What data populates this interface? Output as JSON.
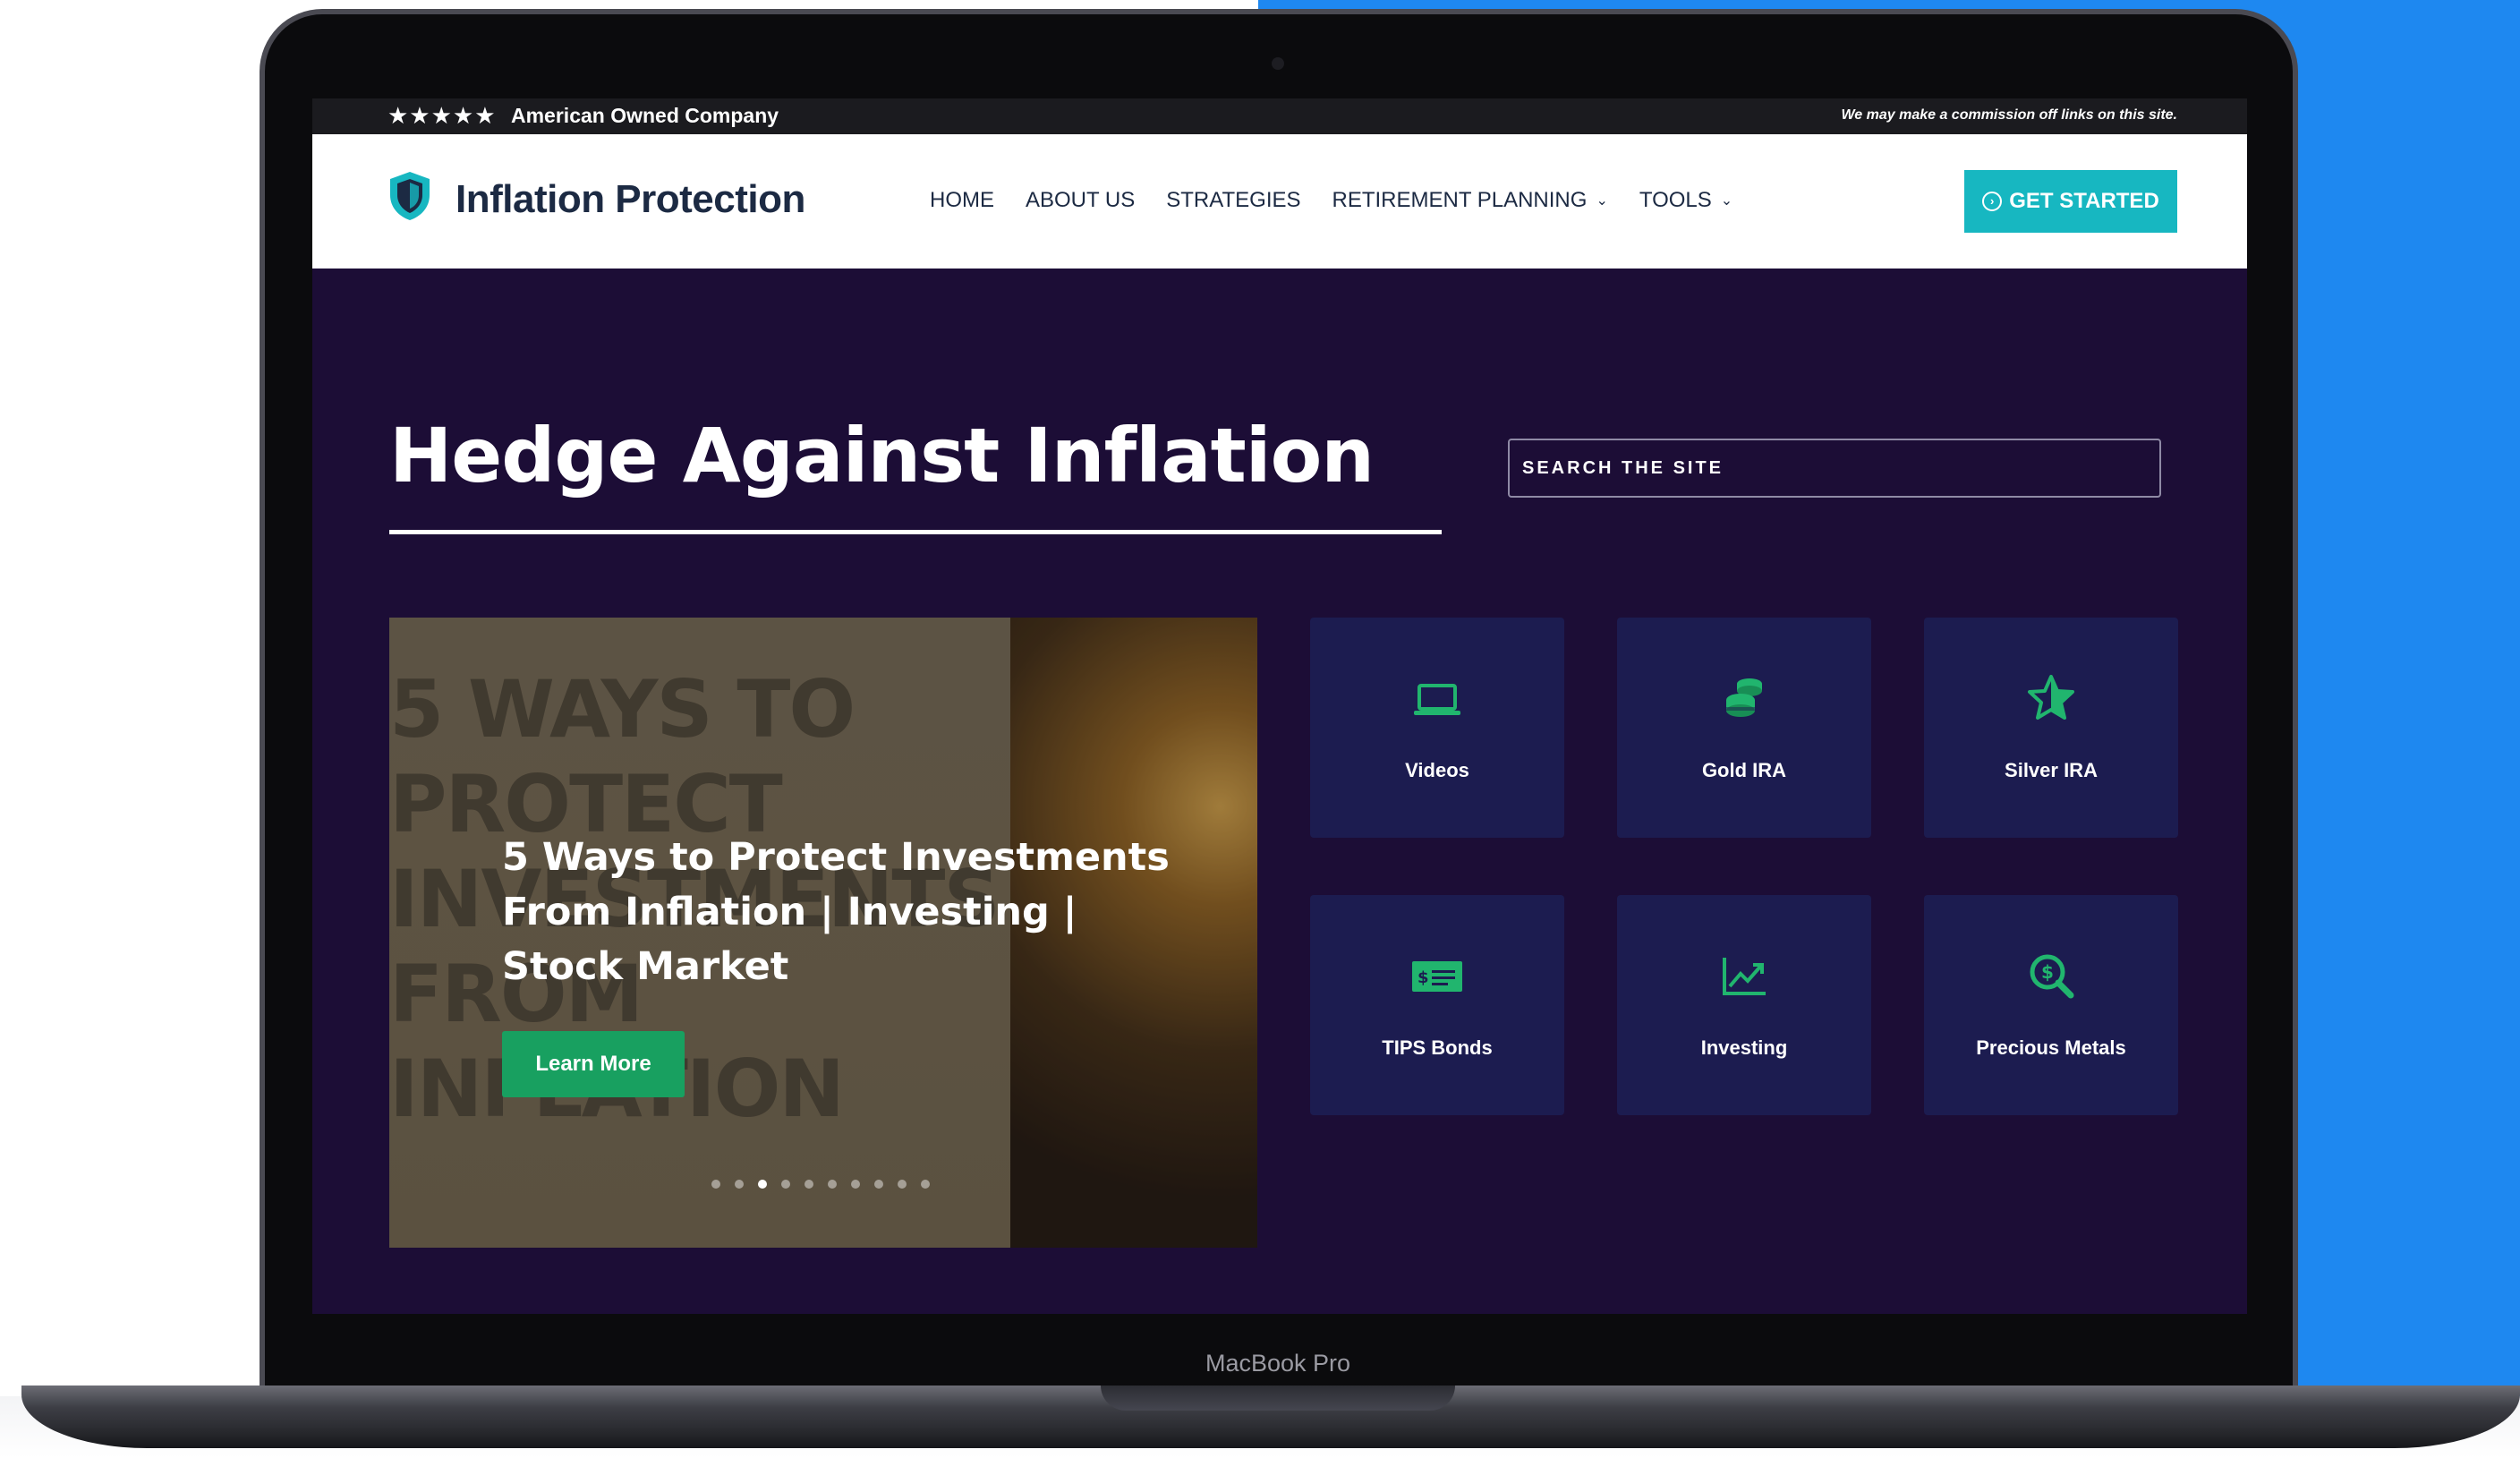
{
  "device": {
    "label": "MacBook Pro"
  },
  "topbar": {
    "stars": "★★★★★",
    "company_tagline": "American Owned Company",
    "disclaimer": "We may make a commission off links on this site."
  },
  "header": {
    "brand": "Inflation Protection",
    "nav": [
      {
        "label": "HOME"
      },
      {
        "label": "ABOUT US"
      },
      {
        "label": "STRATEGIES"
      },
      {
        "label": "RETIREMENT PLANNING",
        "has_dropdown": true
      },
      {
        "label": "TOOLS",
        "has_dropdown": true
      }
    ],
    "cta_label": "GET STARTED"
  },
  "hero": {
    "title": "Hedge Against Inflation",
    "search_placeholder": "SEARCH THE SITE"
  },
  "slider": {
    "thumbnail_text": [
      "5 WAYS TO",
      "PROTECT",
      "INVESTMENTS",
      "FROM",
      "INFLATION"
    ],
    "title": "5 Ways to Protect Investments From Inflation | Investing | Stock Market",
    "button_label": "Learn More",
    "total_slides": 10,
    "active_slide": 3
  },
  "cards": [
    {
      "label": "Videos",
      "icon": "laptop-icon"
    },
    {
      "label": "Gold IRA",
      "icon": "coins-icon"
    },
    {
      "label": "Silver IRA",
      "icon": "star-icon"
    },
    {
      "label": "TIPS Bonds",
      "icon": "money-bill-icon"
    },
    {
      "label": "Investing",
      "icon": "chart-line-icon"
    },
    {
      "label": "Precious Metals",
      "icon": "search-dollar-icon"
    }
  ],
  "colors": {
    "accent_teal": "#17b7c1",
    "accent_green": "#18a060",
    "hero_bg": "#1c0d36",
    "card_bg": "#1c1c50",
    "icon_green": "#21b56e",
    "brand_navy": "#1c2a43",
    "backdrop_blue": "#1e88f0"
  }
}
